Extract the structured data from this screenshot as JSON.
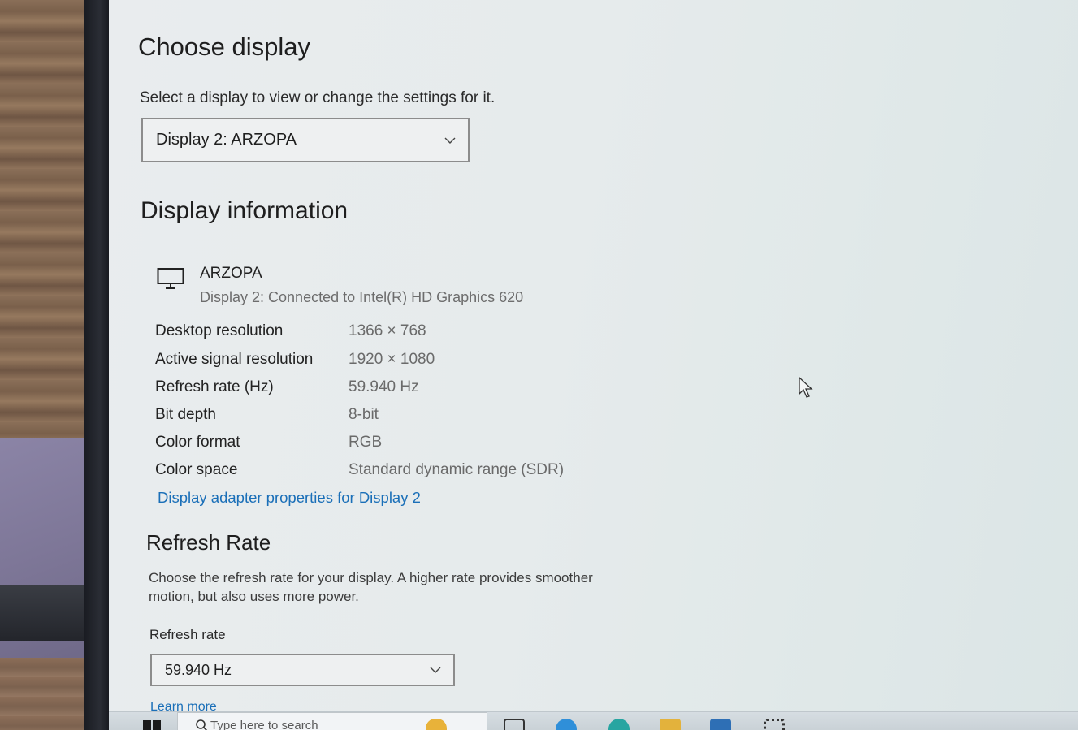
{
  "choose_display": {
    "heading": "Choose display",
    "subtitle": "Select a display to view or change the settings for it.",
    "selected_display": "Display 2: ARZOPA"
  },
  "display_information": {
    "heading": "Display information",
    "display_name": "ARZOPA",
    "display_description": "Display 2: Connected to Intel(R) HD Graphics 620",
    "rows": [
      {
        "label": "Desktop resolution",
        "value": "1366 × 768"
      },
      {
        "label": "Active signal resolution",
        "value": "1920 × 1080"
      },
      {
        "label": "Refresh rate (Hz)",
        "value": "59.940 Hz"
      },
      {
        "label": "Bit depth",
        "value": "8-bit"
      },
      {
        "label": "Color format",
        "value": "RGB"
      },
      {
        "label": "Color space",
        "value": "Standard dynamic range (SDR)"
      }
    ],
    "adapter_link": "Display adapter properties for Display 2"
  },
  "refresh_rate": {
    "heading": "Refresh Rate",
    "description": "Choose the refresh rate for your display. A higher rate provides smoother motion, but also uses more power.",
    "field_label": "Refresh rate",
    "selected_value": "59.940 Hz",
    "learn_more": "Learn more"
  },
  "taskbar": {
    "search_placeholder": "Type here to search",
    "icons": [
      "windows-start-icon",
      "search-icon",
      "widgets-icon",
      "task-view-icon",
      "edge-icon",
      "edge-icon",
      "file-explorer-icon",
      "store-icon",
      "settings-icon"
    ]
  },
  "colors": {
    "link": "#1a6fb8",
    "text_primary": "#1e1e1e",
    "text_secondary": "#6a6a6a"
  }
}
